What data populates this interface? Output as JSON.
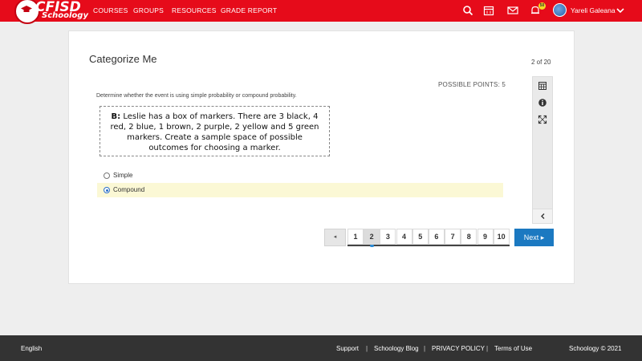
{
  "header": {
    "logo_text": "CFISD",
    "logo_sub": "Schoology",
    "nav": [
      "COURSES",
      "GROUPS",
      "RESOURCES",
      "GRADE REPORT"
    ],
    "notification_count": "50",
    "username": "Yareli Galeana",
    "icons": [
      "search-icon",
      "calendar-icon",
      "mail-icon",
      "bell-icon",
      "chevron-down-icon"
    ],
    "bar_color": "#e60b1a"
  },
  "question": {
    "title": "Categorize Me",
    "count": "2 of 20",
    "points": "POSSIBLE POINTS: 5",
    "prompt": "Determine whether the event is using simple probability or compound probability.",
    "image_label": "B:",
    "image_text": "Leslie has a box of markers. There are 3 black, 4 red, 2 blue, 1 brown, 2 purple, 2 yellow and 5 green markers.  Create a sample space of possible outcomes for choosing a marker.",
    "options": [
      {
        "label": "Simple",
        "selected": false
      },
      {
        "label": "Compound",
        "selected": true
      }
    ]
  },
  "pagination": {
    "prev": "◂",
    "pages": [
      "1",
      "2",
      "3",
      "4",
      "5",
      "6",
      "7",
      "8",
      "9",
      "10"
    ],
    "current": "2",
    "next": "Next ▸"
  },
  "footer": {
    "language": "English",
    "links": [
      "Support",
      "Schoology Blog",
      "PRIVACY POLICY",
      "Terms of Use"
    ],
    "separator": "|",
    "copyright": "Schoology © 2021"
  }
}
